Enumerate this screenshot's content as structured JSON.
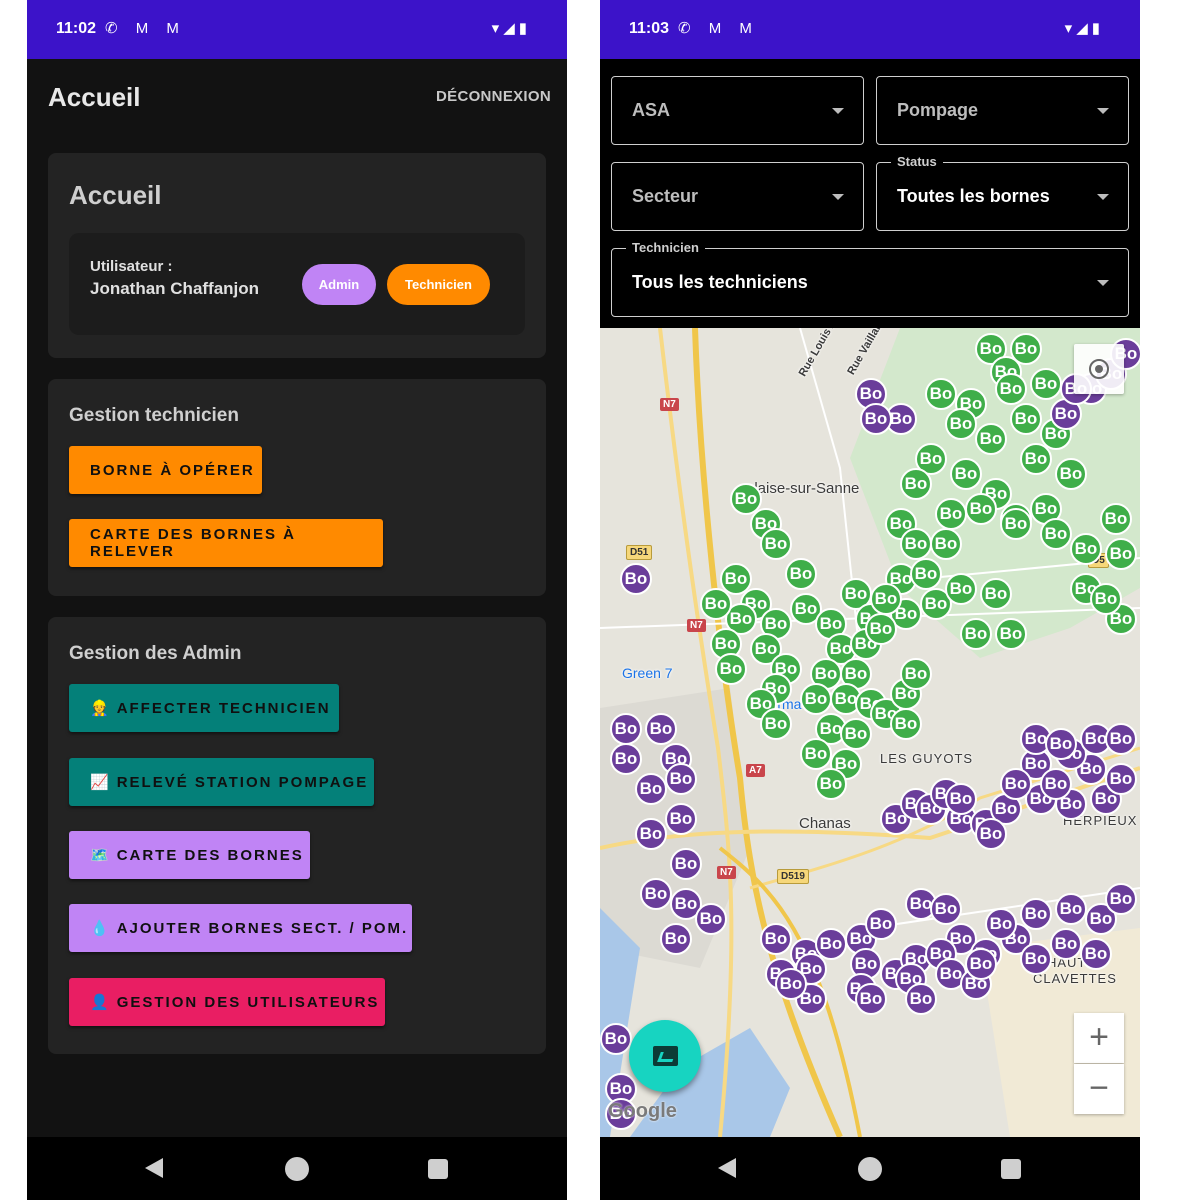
{
  "status_left": {
    "time": "11:02",
    "notif_icons": "✆ M M",
    "sys_icons": "▾◢▮"
  },
  "status_right": {
    "time": "11:03",
    "notif_icons": "✆ M M",
    "sys_icons": "▾◢▮"
  },
  "home": {
    "appbar_title": "Accueil",
    "logout_label": "DÉCONNEXION",
    "welcome_card": {
      "title": "Accueil",
      "user_label": "Utilisateur :",
      "user_name": "Jonathan Chaffanjon",
      "roles": [
        "Admin",
        "Technicien"
      ]
    },
    "tech_card": {
      "title": "Gestion technicien",
      "buttons": [
        "BORNE À OPÉRER",
        "CARTE DES BORNES À RELEVER"
      ]
    },
    "admin_card": {
      "title": "Gestion des Admin",
      "buttons": [
        {
          "emoji": "👷",
          "label": "AFFECTER TECHNICIEN"
        },
        {
          "emoji": "📈",
          "label": "RELEVÉ STATION POMPAGE"
        },
        {
          "emoji": "🗺️",
          "label": "CARTE DES BORNES"
        },
        {
          "emoji": "💧",
          "label": "AJOUTER BORNES SECT. / POM."
        },
        {
          "emoji": "👤",
          "label": "GESTION DES UTILISATEURS"
        }
      ]
    }
  },
  "map_screen": {
    "filters": {
      "asa": "ASA",
      "pompage": "Pompage",
      "secteur": "Secteur",
      "status_legend": "Status",
      "status_value": "Toutes les bornes",
      "technicien_legend": "Technicien",
      "technicien_value": "Tous les techniciens"
    },
    "map_labels": {
      "town1": "alaise-sur-Sanne",
      "town2": "Chanas",
      "area1": "LES GUYOTS",
      "area2": "HERPIEUX",
      "area3_line1": "HAUTES",
      "area3_line2": "CLAVETTES",
      "poi1": "Green 7",
      "poi2": "Interma",
      "street1": "Rue Louis A",
      "street2": "Rue Vaillant-C",
      "roads": [
        "N7",
        "N7",
        "N7",
        "D51",
        "A7",
        "D519",
        "D5"
      ],
      "attribution": "Google"
    },
    "marker_label": "Bo",
    "marker_colors": {
      "active": "#3fae49",
      "inactive": "#6a3d9a"
    },
    "zoom_in": "+",
    "zoom_out": "−"
  }
}
